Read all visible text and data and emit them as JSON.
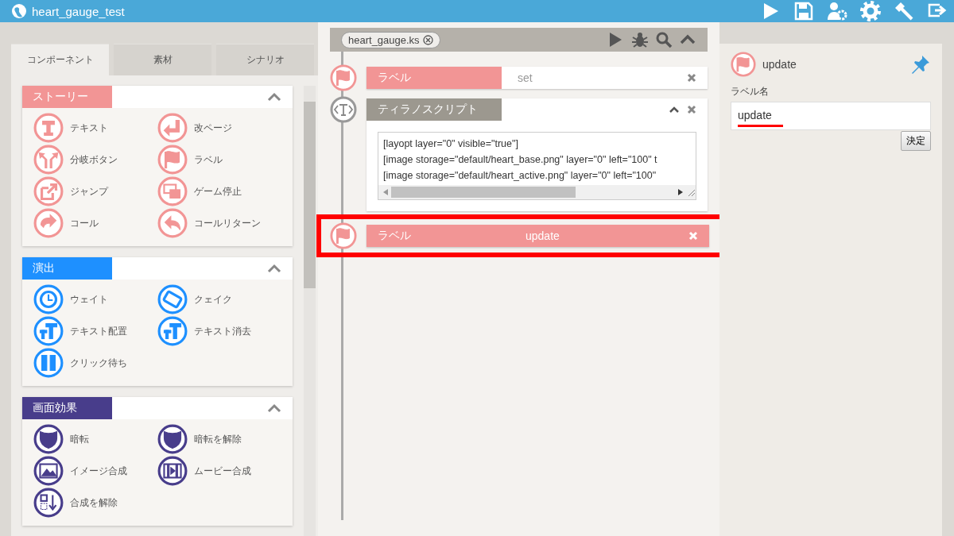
{
  "window": {
    "title": "heart_gauge_test"
  },
  "left_panel": {
    "tabs": [
      {
        "label": "コンポーネント",
        "selected": true
      },
      {
        "label": "素材",
        "selected": false
      },
      {
        "label": "シナリオ",
        "selected": false
      }
    ],
    "sections": [
      {
        "title": "ストーリー",
        "color": "#f29595",
        "expanded": true,
        "items": [
          "テキスト",
          "改ページ",
          "分岐ボタン",
          "ラベル",
          "ジャンプ",
          "ゲーム停止",
          "コール",
          "コールリターン"
        ]
      },
      {
        "title": "演出",
        "color": "#1e90ff",
        "expanded": true,
        "items": [
          "ウェイト",
          "クェイク",
          "テキスト配置",
          "テキスト消去",
          "クリック待ち"
        ]
      },
      {
        "title": "画面効果",
        "color": "#483d8b",
        "expanded": true,
        "items": [
          "暗転",
          "暗転を解除",
          "イメージ合成",
          "ムービー合成",
          "合成を解除"
        ]
      }
    ]
  },
  "editor": {
    "file_tab": "heart_gauge.ks",
    "blocks": [
      {
        "kind": "label",
        "tag": "ラベル",
        "value": "set",
        "selected": false,
        "annotated": false
      },
      {
        "kind": "script",
        "tag": "ティラノスクリプト",
        "lines": [
          "[layopt layer=\"0\" visible=\"true\"]",
          "[image storage=\"default/heart_base.png\" layer=\"0\" left=\"100\" t",
          "[image storage=\"default/heart_active.png\" layer=\"0\" left=\"100\""
        ]
      },
      {
        "kind": "label",
        "tag": "ラベル",
        "value": "update",
        "selected": true,
        "annotated": true
      }
    ]
  },
  "inspector": {
    "title": "update",
    "field_label": "ラベル名",
    "field_value": "update",
    "annotated": true,
    "button": "決定"
  }
}
